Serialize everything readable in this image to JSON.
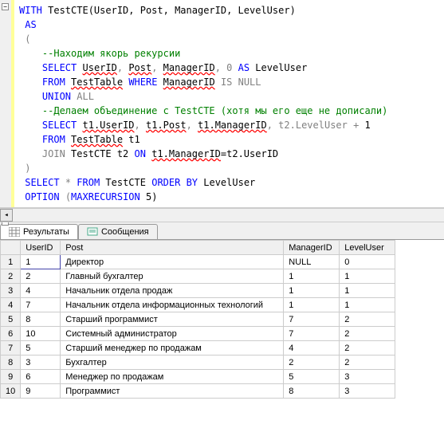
{
  "code": {
    "line1_with": "WITH",
    "line1_rest": " TestCTE(UserID, Post, ManagerID, LevelUser)",
    "line2": "AS",
    "line3": "(",
    "comment1": "--Находим якорь рекурсии",
    "select1": "SELECT",
    "sel1_userid": "UserID",
    "sel1_c1": ", ",
    "sel1_post": "Post",
    "sel1_c2": ", ",
    "sel1_mgr": "ManagerID",
    "sel1_rest": ", 0 ",
    "sel1_as": "AS",
    "sel1_lvl": " LevelUser",
    "from1": "FROM",
    "from1_tbl": "TestTable",
    "where1": "WHERE",
    "where1_mgr": "ManagerID",
    "isnull": "IS NULL",
    "union": "UNION",
    "all": "ALL",
    "comment2": "--Делаем объединение с TestCTE (хотя мы его еще не дописали)",
    "select2": "SELECT",
    "sel2_a": "t1.UserID",
    "sel2_c1": ", ",
    "sel2_b": "t1.Post",
    "sel2_c2": ", ",
    "sel2_c": "t1.ManagerID",
    "sel2_rest": ", t2.LevelUser ",
    "plus": "+",
    "one": " 1",
    "from2": "FROM",
    "from2_tbl": "TestTable",
    "from2_alias": " t1",
    "join": "JOIN",
    "join_rest1": " TestCTE t2 ",
    "on": "ON",
    "join_col": "t1.ManagerID",
    "join_eq": "=t2.UserID",
    "closep": ")",
    "final_select": "SELECT",
    "final_star": " * ",
    "final_from": "FROM",
    "final_tbl": " TestCTE ",
    "final_order": "ORDER BY",
    "final_col": " LevelUser",
    "option": "OPTION",
    "option_p": " (",
    "maxrec": "MAXRECURSION",
    "maxrec_v": " 5)"
  },
  "tabs": {
    "results": "Результаты",
    "messages": "Сообщения"
  },
  "grid": {
    "headers": {
      "userid": "UserID",
      "post": "Post",
      "managerid": "ManagerID",
      "leveluser": "LevelUser"
    },
    "rows": [
      {
        "n": "1",
        "userid": "1",
        "post": "Директор",
        "managerid": "NULL",
        "leveluser": "0"
      },
      {
        "n": "2",
        "userid": "2",
        "post": "Главный бухгалтер",
        "managerid": "1",
        "leveluser": "1"
      },
      {
        "n": "3",
        "userid": "4",
        "post": "Начальник отдела продаж",
        "managerid": "1",
        "leveluser": "1"
      },
      {
        "n": "4",
        "userid": "7",
        "post": "Начальник отдела информационных технологий",
        "managerid": "1",
        "leveluser": "1"
      },
      {
        "n": "5",
        "userid": "8",
        "post": "Старший программист",
        "managerid": "7",
        "leveluser": "2"
      },
      {
        "n": "6",
        "userid": "10",
        "post": "Системный администратор",
        "managerid": "7",
        "leveluser": "2"
      },
      {
        "n": "7",
        "userid": "5",
        "post": "Старший менеджер по продажам",
        "managerid": "4",
        "leveluser": "2"
      },
      {
        "n": "8",
        "userid": "3",
        "post": "Бухгалтер",
        "managerid": "2",
        "leveluser": "2"
      },
      {
        "n": "9",
        "userid": "6",
        "post": "Менеджер по продажам",
        "managerid": "5",
        "leveluser": "3"
      },
      {
        "n": "10",
        "userid": "9",
        "post": "Программист",
        "managerid": "8",
        "leveluser": "3"
      }
    ]
  }
}
